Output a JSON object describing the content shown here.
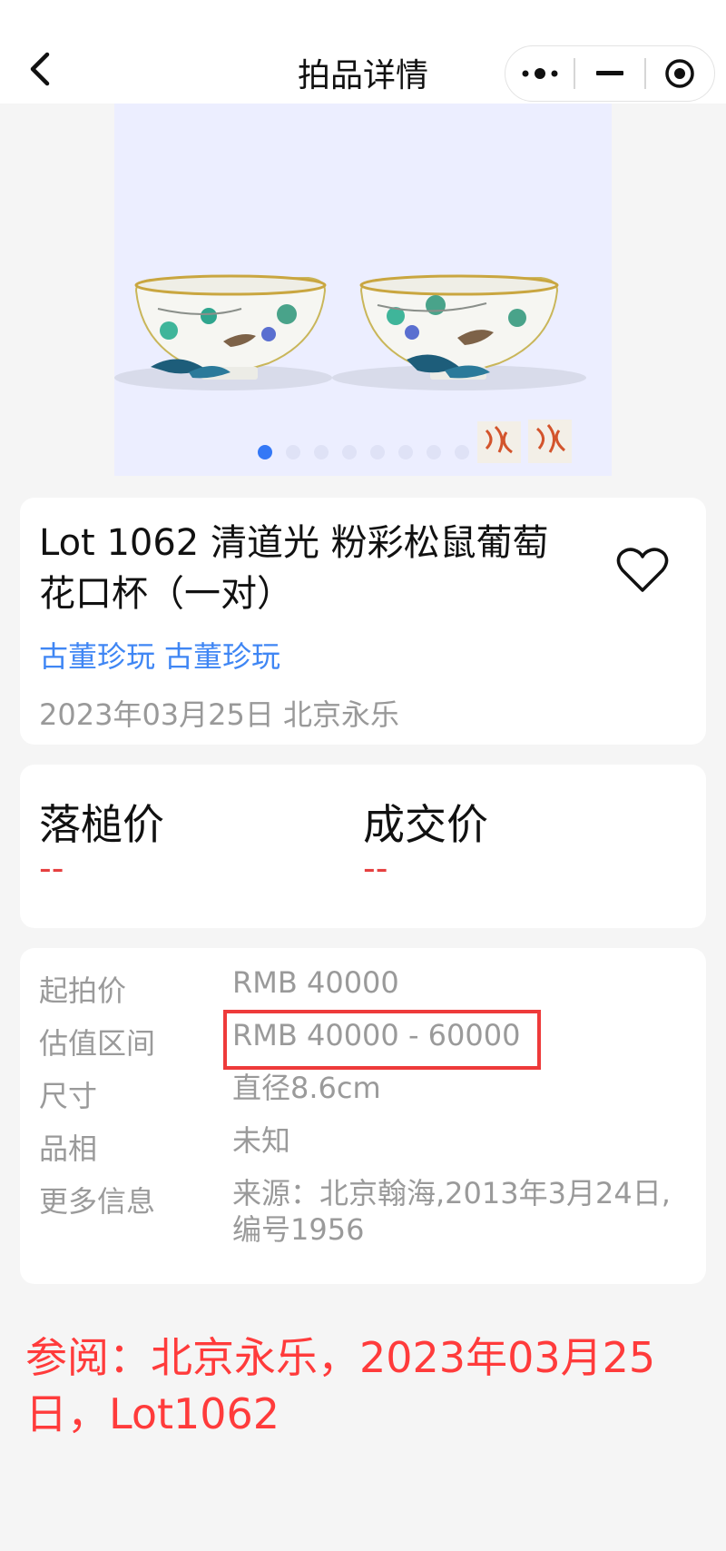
{
  "header": {
    "title": "拍品详情",
    "back_icon": "chevron-left-icon",
    "menu_icon": "more-dots-icon",
    "minimize_icon": "minus-icon",
    "close_icon": "target-circle-icon"
  },
  "gallery": {
    "image_subject": "pair of famille-rose bowls with squirrel and grape decoration",
    "slide_count": 8,
    "active_slide": 1,
    "active_dot_color": "#3478f6"
  },
  "lot": {
    "title": "Lot 1062 清道光 粉彩松鼠葡萄花口杯（一对）",
    "tags": [
      "古董珍玩",
      "古董珍玩"
    ],
    "date_house": "2023年03月25日 北京永乐",
    "favorite_icon": "heart-outline-icon"
  },
  "prices": {
    "hammer_label": "落槌价",
    "hammer_value": "--",
    "final_label": "成交价",
    "final_value": "--"
  },
  "details": [
    {
      "key": "起拍价",
      "value": "RMB 40000"
    },
    {
      "key": "估值区间",
      "value": "RMB 40000 - 60000"
    },
    {
      "key": "尺寸",
      "value": "直径8.6cm"
    },
    {
      "key": "品相",
      "value": "未知"
    },
    {
      "key": "更多信息",
      "value": "来源：北京翰海,2013年3月24日,",
      "value_line2": "编号1956"
    }
  ],
  "reference_note": "参阅：北京永乐，2023年03月25日，Lot1062",
  "colors": {
    "accent_blue": "#3f86f4",
    "price_red": "#e64040",
    "note_red": "#ff3b3b",
    "highlight_red": "#ee3a3a"
  }
}
